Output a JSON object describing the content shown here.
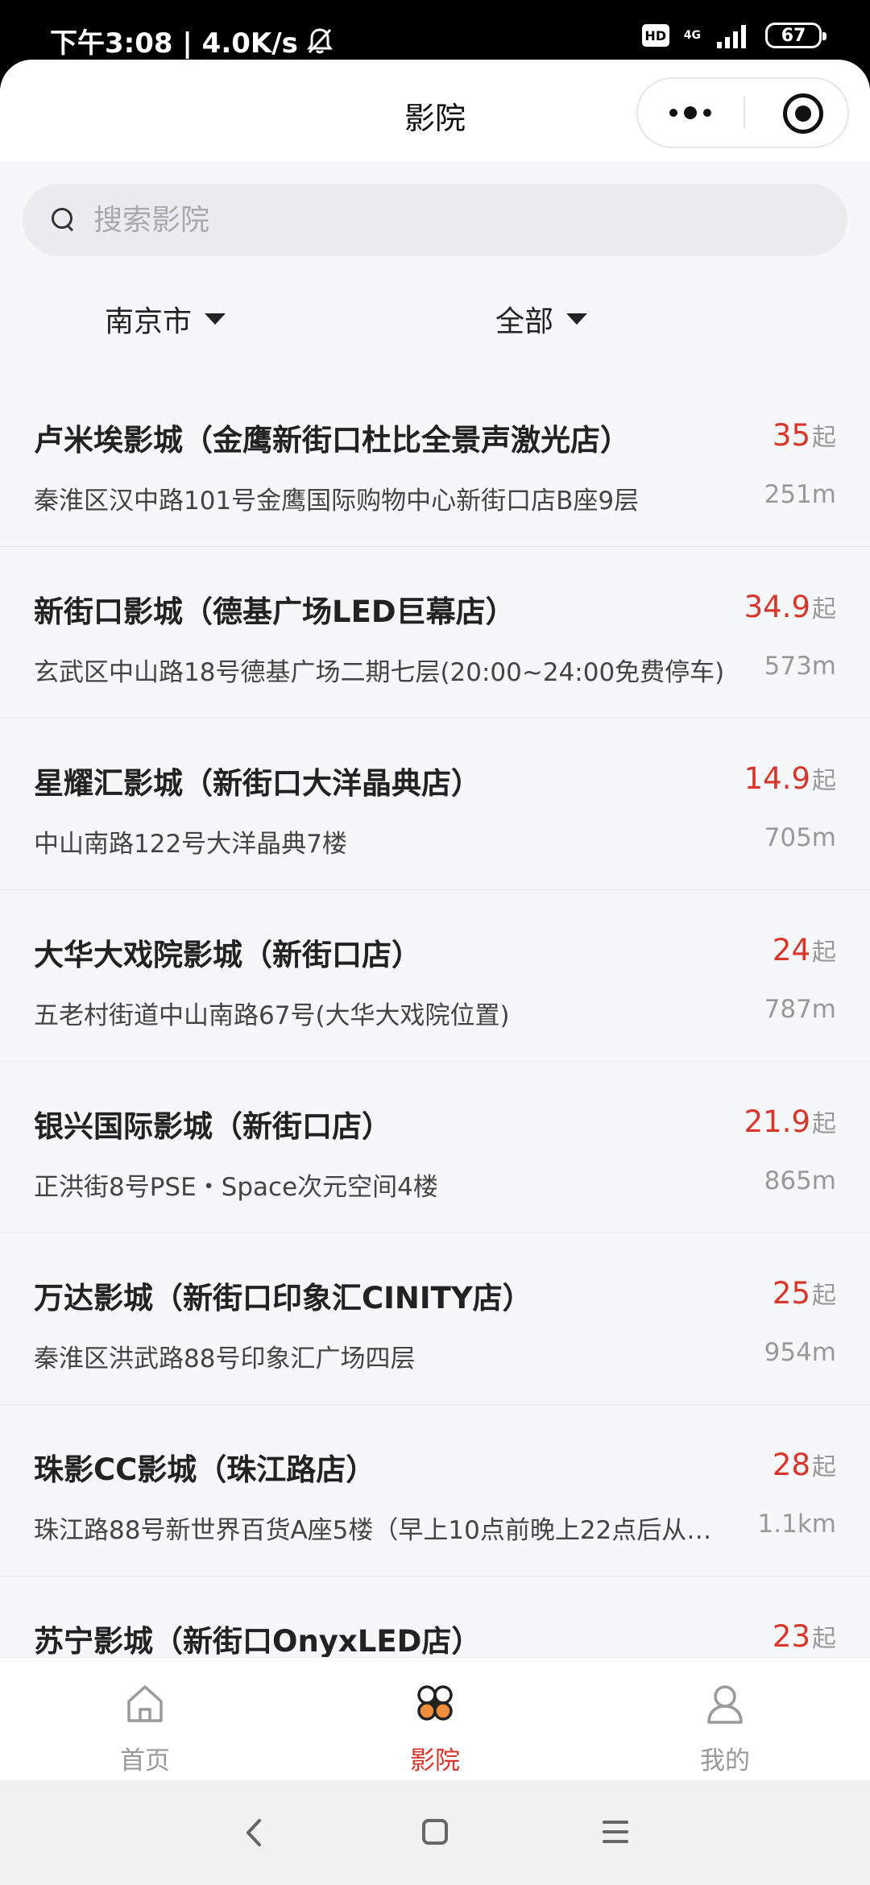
{
  "status": {
    "time_speed": "下午3:08 | 4.0K/s",
    "hd": "HD",
    "network": "4G",
    "battery": "67"
  },
  "nav": {
    "title": "影院"
  },
  "search": {
    "placeholder": "搜索影院"
  },
  "filters": {
    "city": "南京市",
    "category": "全部"
  },
  "price_unit": "起",
  "cinemas": [
    {
      "name": "卢米埃影城（金鹰新街口杜比全景声激光店）",
      "price": "35",
      "address": "秦淮区汉中路101号金鹰国际购物中心新街口店B座9层",
      "distance": "251m"
    },
    {
      "name": "新街口影城（德基广场LED巨幕店）",
      "price": "34.9",
      "address": "玄武区中山路18号德基广场二期七层(20:00~24:00免费停车)",
      "distance": "573m"
    },
    {
      "name": "星耀汇影城（新街口大洋晶典店）",
      "price": "14.9",
      "address": "中山南路122号大洋晶典7楼",
      "distance": "705m"
    },
    {
      "name": "大华大戏院影城（新街口店）",
      "price": "24",
      "address": "五老村街道中山南路67号(大华大戏院位置)",
      "distance": "787m"
    },
    {
      "name": "银兴国际影城（新街口店）",
      "price": "21.9",
      "address": "正洪街8号PSE・Space次元空间4楼",
      "distance": "865m"
    },
    {
      "name": "万达影城（新街口印象汇CINITY店）",
      "price": "25",
      "address": "秦淮区洪武路88号印象汇广场四层",
      "distance": "954m"
    },
    {
      "name": "珠影CC影城（珠江路店）",
      "price": "28",
      "address": "珠江路88号新世界百货A座5楼（早上10点前晚上22点后从…",
      "distance": "1.1km"
    },
    {
      "name": "苏宁影城（新街口OnyxLED店）",
      "price": "23",
      "address": "",
      "distance": ""
    }
  ],
  "tabbar": {
    "home": "首页",
    "cinema": "影院",
    "mine": "我的"
  },
  "colors": {
    "accent": "#d9352b",
    "background": "#f6f7f9"
  }
}
